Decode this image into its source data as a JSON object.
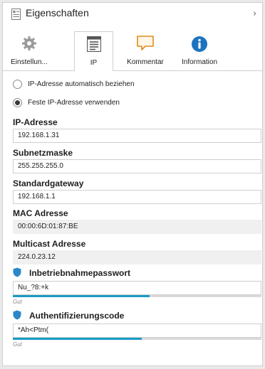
{
  "panel": {
    "title": "Eigenschaften",
    "title_icon": "properties-icon",
    "collapse_icon": "chevron-right-icon"
  },
  "tabs": [
    {
      "label": "Einstellun...",
      "icon": "gear-icon",
      "active": false
    },
    {
      "label": "IP",
      "icon": "ip-list-icon",
      "active": true
    },
    {
      "label": "Kommentar",
      "icon": "comment-icon",
      "active": false
    },
    {
      "label": "Information",
      "icon": "info-icon",
      "active": false
    }
  ],
  "ip_mode": {
    "auto_label": "IP-Adresse automatisch beziehen",
    "fixed_label": "Feste IP-Adresse verwenden",
    "selected": "fixed"
  },
  "fields": {
    "ip": {
      "label": "IP-Adresse",
      "value": "192.168.1.31"
    },
    "subnet": {
      "label": "Subnetzmaske",
      "value": "255.255.255.0"
    },
    "gateway": {
      "label": "Standardgateway",
      "value": "192.168.1.1"
    },
    "mac": {
      "label": "MAC Adresse",
      "value": "00:00:6D:01:87:BE"
    },
    "multicast": {
      "label": "Multicast Adresse",
      "value": "224.0.23.12"
    },
    "commissioning_password": {
      "label": "Inbetriebnahmepasswort",
      "value": "Nu_?8:+k",
      "strength_text": "Gut",
      "strength_level": 0.55
    },
    "auth_code": {
      "label": "Authentifizierungscode",
      "value": "*Ah<Ptm(",
      "strength_text": "Gut",
      "strength_level": 0.52
    }
  },
  "colors": {
    "accent": "#1a9bc4",
    "shield": "#2a87c8"
  }
}
